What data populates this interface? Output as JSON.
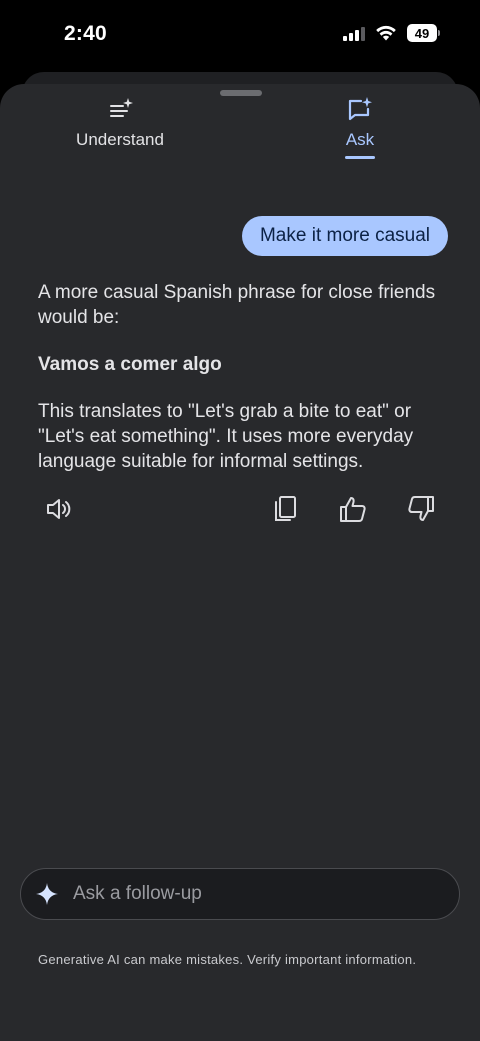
{
  "status_bar": {
    "time": "2:40",
    "battery": "49"
  },
  "tabs": [
    {
      "label": "Understand",
      "icon": "sparkle-list-icon",
      "active": false
    },
    {
      "label": "Ask",
      "icon": "sparkle-chat-icon",
      "active": true
    }
  ],
  "conversation": {
    "user_message": "Make it more casual",
    "answer": {
      "intro": "A more casual Spanish phrase for close friends would be:",
      "phrase": "Vamos a comer algo",
      "explanation": "This translates to \"Let's grab a bite to eat\" or \"Let's eat something\". It uses more everyday language suitable for informal settings."
    }
  },
  "actions": [
    "speaker-icon",
    "copy-icon",
    "thumbs-up-icon",
    "thumbs-down-icon"
  ],
  "input": {
    "placeholder": "Ask a follow-up"
  },
  "disclaimer": "Generative AI can make mistakes. Verify important information.",
  "colors": {
    "accent": "#a9c7ff",
    "sheet": "#28292c",
    "bubble_text": "#0c2245"
  }
}
